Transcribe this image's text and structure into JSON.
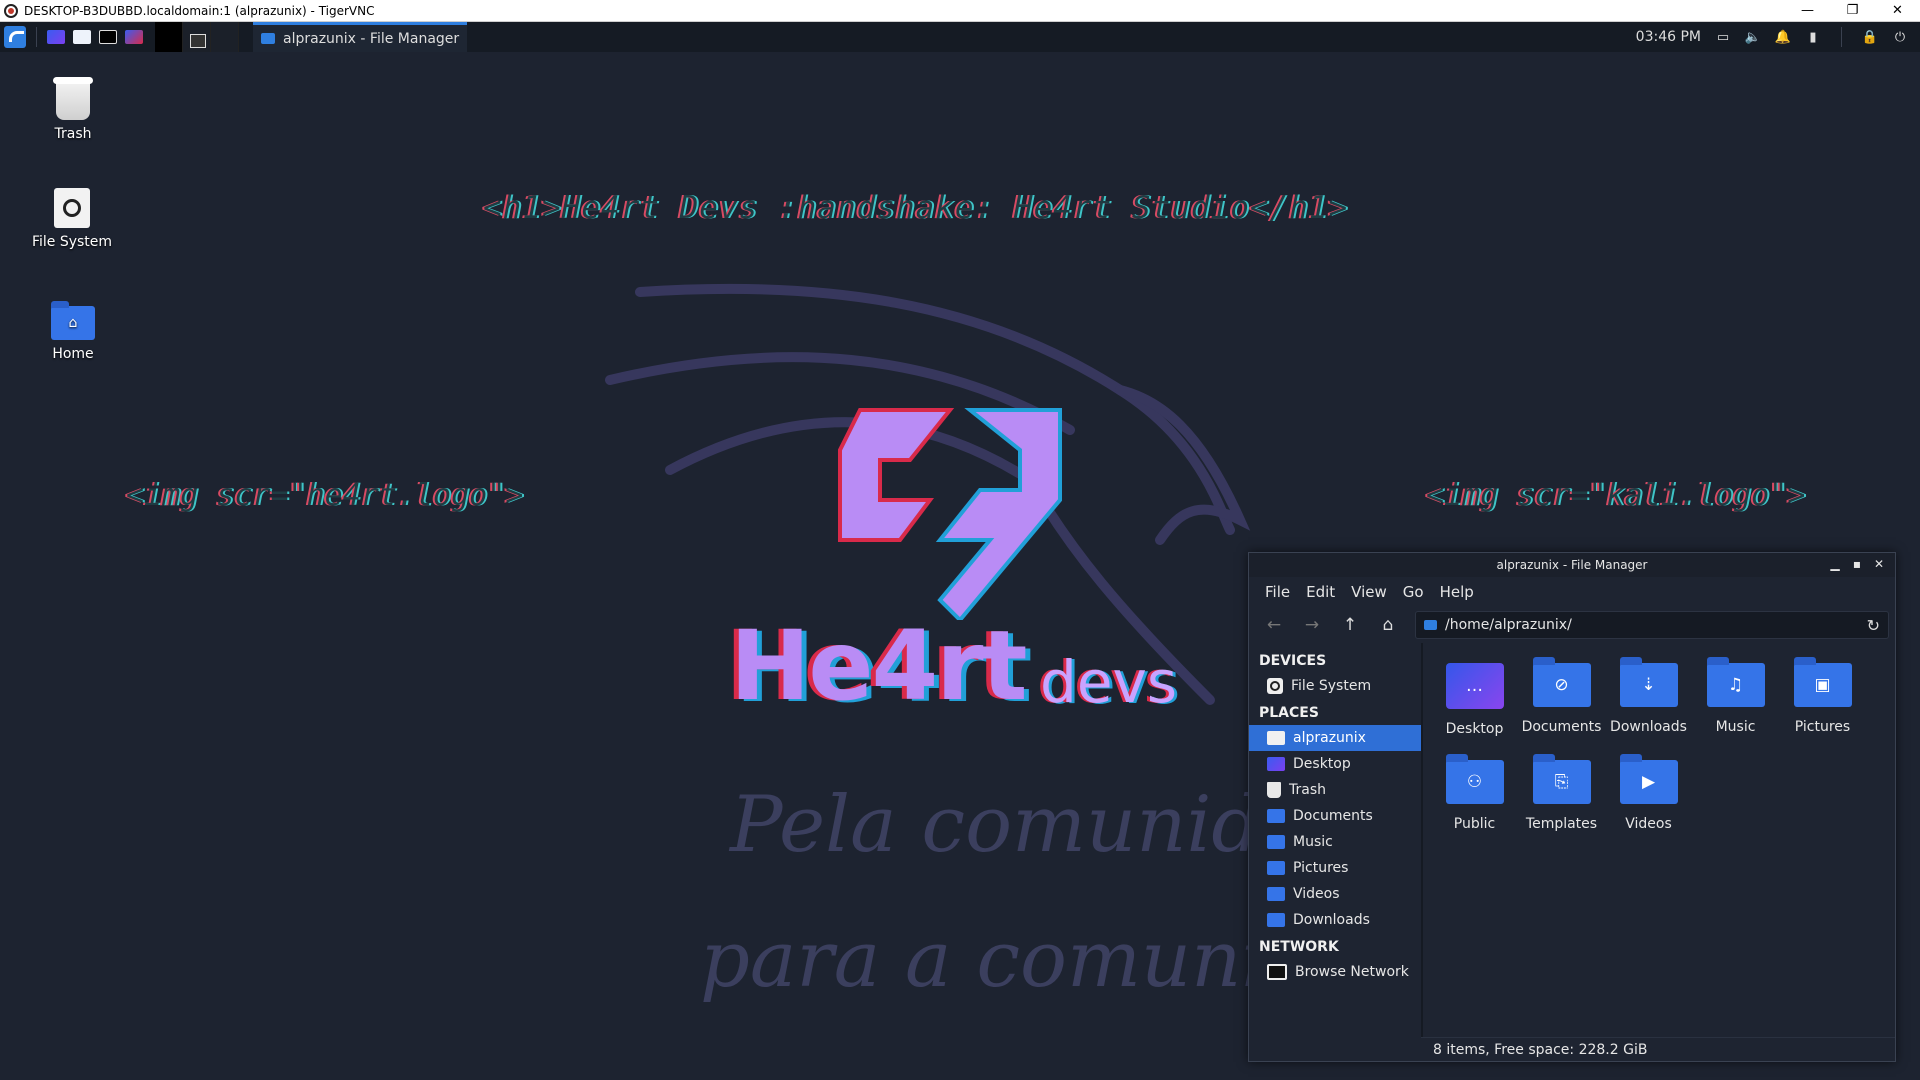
{
  "vnc_window": {
    "title": "DESKTOP-B3DUBBD.localdomain:1 (alprazunix) - TigerVNC",
    "controls": [
      "—",
      "❐",
      "✕"
    ]
  },
  "top_panel": {
    "task_label": "alprazunix - File Manager",
    "clock": "03:46 PM"
  },
  "desktop_icons": [
    {
      "label": "Trash"
    },
    {
      "label": "File System"
    },
    {
      "label": "Home"
    }
  ],
  "wallpaper": {
    "headline": "<h1>He4rt Devs :handshake: He4rt Studio</h1>",
    "img_left": "<img scr=\"he4rt.logo\">",
    "img_right": "<img scr=\"kali.logo\">",
    "brand": "He4rt",
    "brand_sub": "devs",
    "script_line1": "Pela comunidade",
    "script_line2": "para a comunidade"
  },
  "file_manager": {
    "title": "alprazunix - File Manager",
    "menu": [
      "File",
      "Edit",
      "View",
      "Go",
      "Help"
    ],
    "location": "/home/alprazunix/",
    "sidebar": {
      "devices_heading": "DEVICES",
      "devices": [
        "File System"
      ],
      "places_heading": "PLACES",
      "places": [
        "alprazunix",
        "Desktop",
        "Trash",
        "Documents",
        "Music",
        "Pictures",
        "Videos",
        "Downloads"
      ],
      "network_heading": "NETWORK",
      "network": [
        "Browse Network"
      ],
      "selected": "alprazunix"
    },
    "items": [
      "Desktop",
      "Documents",
      "Downloads",
      "Music",
      "Pictures",
      "Public",
      "Templates",
      "Videos"
    ],
    "status": "8 items, Free space: 228.2 GiB"
  },
  "colors": {
    "desktop_bg": "#1d2330",
    "accent": "#2f7fe0",
    "folder": "#3574e8"
  }
}
